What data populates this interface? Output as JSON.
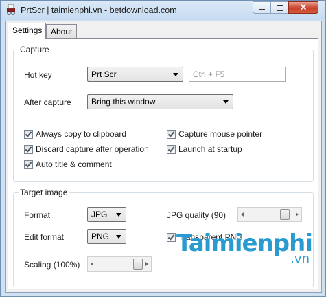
{
  "window": {
    "title": "PrtScr | taimienphi.vn - betdownload.com",
    "icon": "printer-scissors-icon",
    "buttons": {
      "minimize": "minimize-icon",
      "maximize": "maximize-icon",
      "close": "close-icon",
      "close_glyph": "✕"
    }
  },
  "tabs": [
    {
      "label": "Settings",
      "active": true
    },
    {
      "label": "About",
      "active": false
    }
  ],
  "capture": {
    "group_label": "Capture",
    "hotkey": {
      "label": "Hot key",
      "value": "Prt Scr",
      "alt_value": "Ctrl + F5"
    },
    "after_capture": {
      "label": "After capture",
      "value": "Bring this window"
    },
    "checkboxes": {
      "always_copy": {
        "label": "Always copy to clipboard",
        "checked": true
      },
      "capture_pointer": {
        "label": "Capture mouse pointer",
        "checked": true
      },
      "discard": {
        "label": "Discard capture after operation",
        "checked": true
      },
      "launch_startup": {
        "label": "Launch at startup",
        "checked": true
      },
      "auto_title": {
        "label": "Auto title & comment",
        "checked": true
      }
    }
  },
  "target": {
    "group_label": "Target image",
    "format": {
      "label": "Format",
      "value": "JPG"
    },
    "jpg_quality": {
      "label": "JPG quality (90)",
      "value": 90
    },
    "edit_format": {
      "label": "Edit format",
      "value": "PNG"
    },
    "transparent_png": {
      "label": "Transparent PNG",
      "checked": true
    },
    "scaling": {
      "label": "Scaling (100%)",
      "value": 100
    }
  },
  "watermark": {
    "main": "Taimienphi",
    "sub": ".vn"
  },
  "colors": {
    "accent": "#2a9bd0",
    "frame": "#cfe0f2",
    "close": "#c7402a"
  }
}
